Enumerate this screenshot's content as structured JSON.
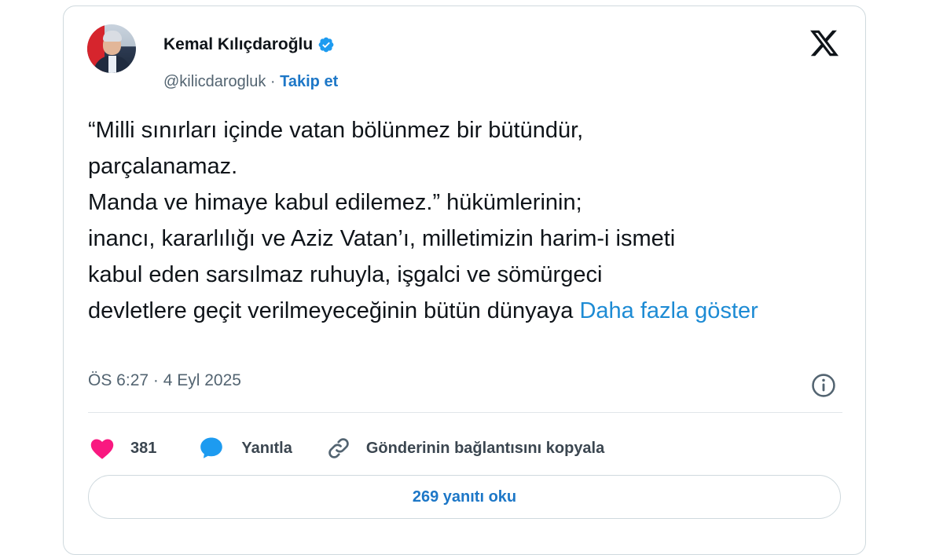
{
  "author": {
    "name": "Kemal Kılıçdaroğlu",
    "handle": "@kilicdarogluk",
    "separator": " · ",
    "follow_label": "Takip et"
  },
  "tweet": {
    "lines": [
      "“Milli sınırları içinde vatan bölünmez bir bütündür,",
      "parçalanamaz.",
      "Manda ve himaye kabul edilemez.” hükümlerinin;",
      "inancı, kararlılığı ve Aziz Vatan’ı, milletimizin harim-i ismeti",
      "kabul eden sarsılmaz ruhuyla, işgalci ve sömürgeci",
      "devletlere geçit verilmeyeceğinin bütün dünyaya "
    ],
    "show_more": "Daha fazla göster",
    "timestamp": "ÖS 6:27 · 4 Eyl 2025"
  },
  "actions": {
    "like_count": "381",
    "reply_label": "Yanıtla",
    "copy_link_label": "Gönderinin bağlantısını kopyala",
    "read_replies_label": "269 yanıtı oku"
  },
  "icons": {
    "verified": "verified-badge-icon",
    "x_logo": "x-logo-icon",
    "info": "info-icon",
    "like": "heart-icon",
    "reply": "speech-bubble-icon",
    "copy": "link-icon"
  },
  "colors": {
    "link_blue": "#1d77c7",
    "show_more_blue": "#1d8bd4",
    "verified_blue": "#1d9bf0",
    "heart_pink": "#f91880",
    "reply_blue": "#1d9bf0",
    "muted_text": "#536471"
  }
}
